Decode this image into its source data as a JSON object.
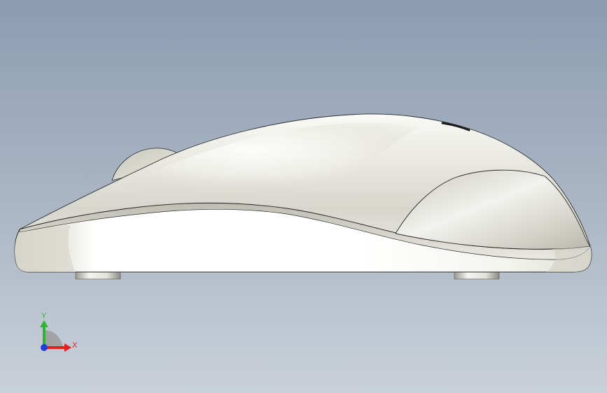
{
  "viewport": {
    "background_top": "#8d9db2",
    "background_bottom": "#c7ced8"
  },
  "model": {
    "icon": "computer-mouse-side-view",
    "body_color": "#f2f2ec",
    "edge_color": "#2a2a2a"
  },
  "triad": {
    "x_label": "X",
    "y_label": "Y",
    "x_color": "#e0201c",
    "y_color": "#2fb52f",
    "z_color": "#1f3fd8"
  }
}
